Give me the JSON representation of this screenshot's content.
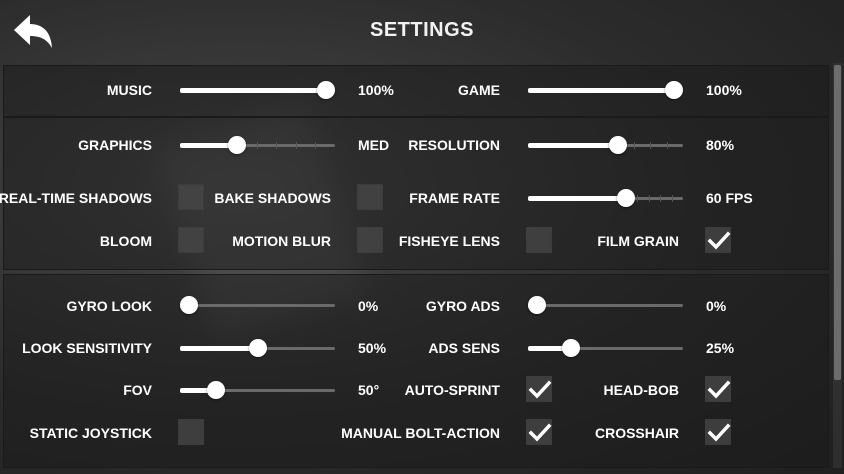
{
  "header": {
    "title": "SETTINGS",
    "back_icon": "back-arrow-icon"
  },
  "colors": {
    "track": "#6a6a6a",
    "fill": "#ffffff",
    "checkbox_bg": "#484848",
    "text": "#ffffff"
  },
  "audio": {
    "music": {
      "label": "MUSIC",
      "value": 1.0,
      "value_text": "100%"
    },
    "game": {
      "label": "GAME",
      "value": 1.0,
      "value_text": "100%"
    }
  },
  "video": {
    "graphics": {
      "label": "GRAPHICS",
      "value": 0.35,
      "value_text": "MED"
    },
    "resolution": {
      "label": "RESOLUTION",
      "value": 0.59,
      "value_text": "80%"
    },
    "real_time_shadows": {
      "label": "REAL-TIME SHADOWS",
      "checked": false
    },
    "bake_shadows": {
      "label": "BAKE SHADOWS",
      "checked": false
    },
    "frame_rate": {
      "label": "FRAME RATE",
      "value": 0.65,
      "value_text": "60 FPS"
    },
    "bloom": {
      "label": "BLOOM",
      "checked": false
    },
    "motion_blur": {
      "label": "MOTION BLUR",
      "checked": false
    },
    "fisheye_lens": {
      "label": "FISHEYE LENS",
      "checked": false
    },
    "film_grain": {
      "label": "FILM GRAIN",
      "checked": true
    }
  },
  "controls": {
    "gyro_look": {
      "label": "GYRO LOOK",
      "value": 0.0,
      "value_text": "0%"
    },
    "gyro_ads": {
      "label": "GYRO ADS",
      "value": 0.0,
      "value_text": "0%"
    },
    "look_sensitivity": {
      "label": "LOOK SENSITIVITY",
      "value": 0.5,
      "value_text": "50%"
    },
    "ads_sens": {
      "label": "ADS SENS",
      "value": 0.25,
      "value_text": "25%"
    },
    "fov": {
      "label": "FOV",
      "value": 0.2,
      "value_text": "50°"
    },
    "auto_sprint": {
      "label": "AUTO-SPRINT",
      "checked": true
    },
    "head_bob": {
      "label": "HEAD-BOB",
      "checked": true
    },
    "static_joystick": {
      "label": "STATIC JOYSTICK",
      "checked": false
    },
    "manual_bolt_action": {
      "label": "MANUAL BOLT-ACTION",
      "checked": true
    },
    "crosshair": {
      "label": "CROSSHAIR",
      "checked": true
    }
  }
}
